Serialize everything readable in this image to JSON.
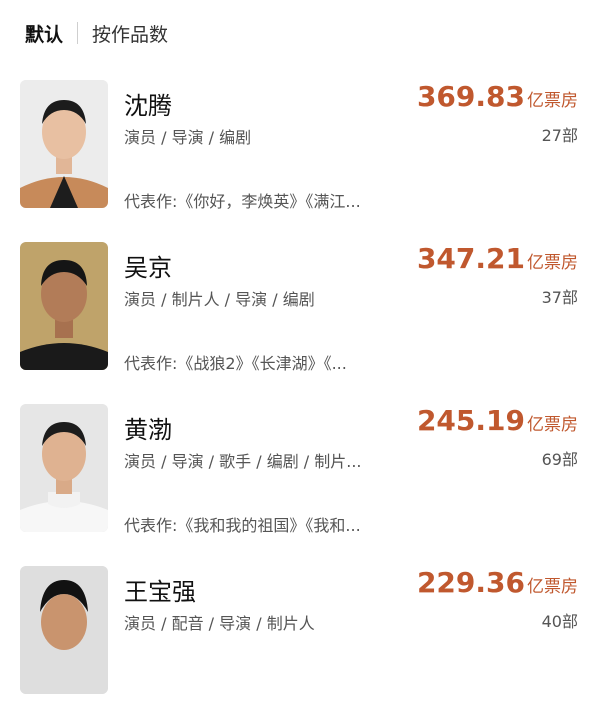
{
  "tabs": {
    "default_label": "默认",
    "sort_label": "按作品数"
  },
  "box_unit": "亿票房",
  "actors": [
    {
      "name": "沈腾",
      "roles": "演员 / 导演 / 编剧",
      "box_office": "369.83",
      "works_count": "27部",
      "representative": "代表作:《你好，李焕英》《满江..."
    },
    {
      "name": "吴京",
      "roles": "演员 / 制片人 / 导演 / 编剧",
      "box_office": "347.21",
      "works_count": "37部",
      "representative": "代表作:《战狼2》《长津湖》《..."
    },
    {
      "name": "黄渤",
      "roles": "演员 / 导演 / 歌手 / 编剧 / 制片...",
      "box_office": "245.19",
      "works_count": "69部",
      "representative": "代表作:《我和我的祖国》《我和..."
    },
    {
      "name": "王宝强",
      "roles": "演员 / 配音 / 导演 / 制片人",
      "box_office": "229.36",
      "works_count": "40部",
      "representative": ""
    }
  ],
  "colors": {
    "accent": "#c0582e",
    "text_primary": "#111111",
    "text_secondary": "#555555"
  }
}
